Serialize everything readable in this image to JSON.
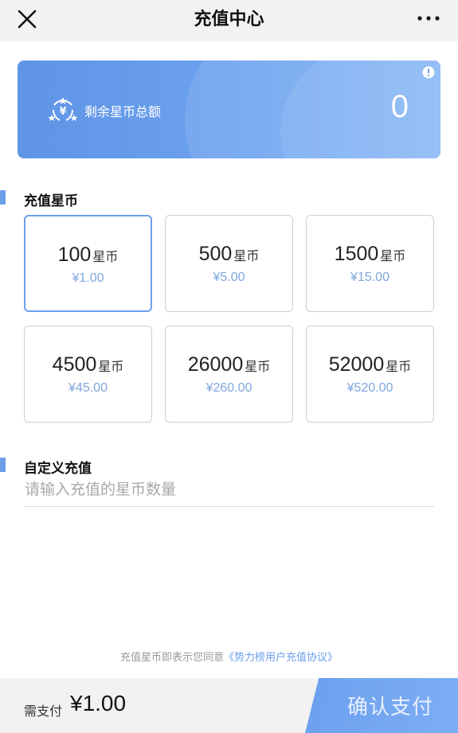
{
  "header": {
    "title": "充值中心"
  },
  "balance": {
    "label": "剩余星币总额",
    "value": "0"
  },
  "recharge_section": {
    "title": "充值星币",
    "options": [
      {
        "amount": "100",
        "unit": "星币",
        "price": "¥1.00",
        "selected": true
      },
      {
        "amount": "500",
        "unit": "星币",
        "price": "¥5.00",
        "selected": false
      },
      {
        "amount": "1500",
        "unit": "星币",
        "price": "¥15.00",
        "selected": false
      },
      {
        "amount": "4500",
        "unit": "星币",
        "price": "¥45.00",
        "selected": false
      },
      {
        "amount": "26000",
        "unit": "星币",
        "price": "¥260.00",
        "selected": false
      },
      {
        "amount": "52000",
        "unit": "星币",
        "price": "¥520.00",
        "selected": false
      }
    ]
  },
  "custom_section": {
    "title": "自定义充值",
    "placeholder": "请输入充值的星币数量",
    "value": ""
  },
  "agreement": {
    "text": "充值星币即表示您同意",
    "link": "《势力榜用户充值协议》"
  },
  "footer": {
    "need_label": "需支付",
    "total": "¥1.00",
    "confirm_label": "确认支付"
  },
  "colors": {
    "accent": "#6b9ee9",
    "price": "#7fa6de",
    "header_bg": "#f2f2f2"
  }
}
